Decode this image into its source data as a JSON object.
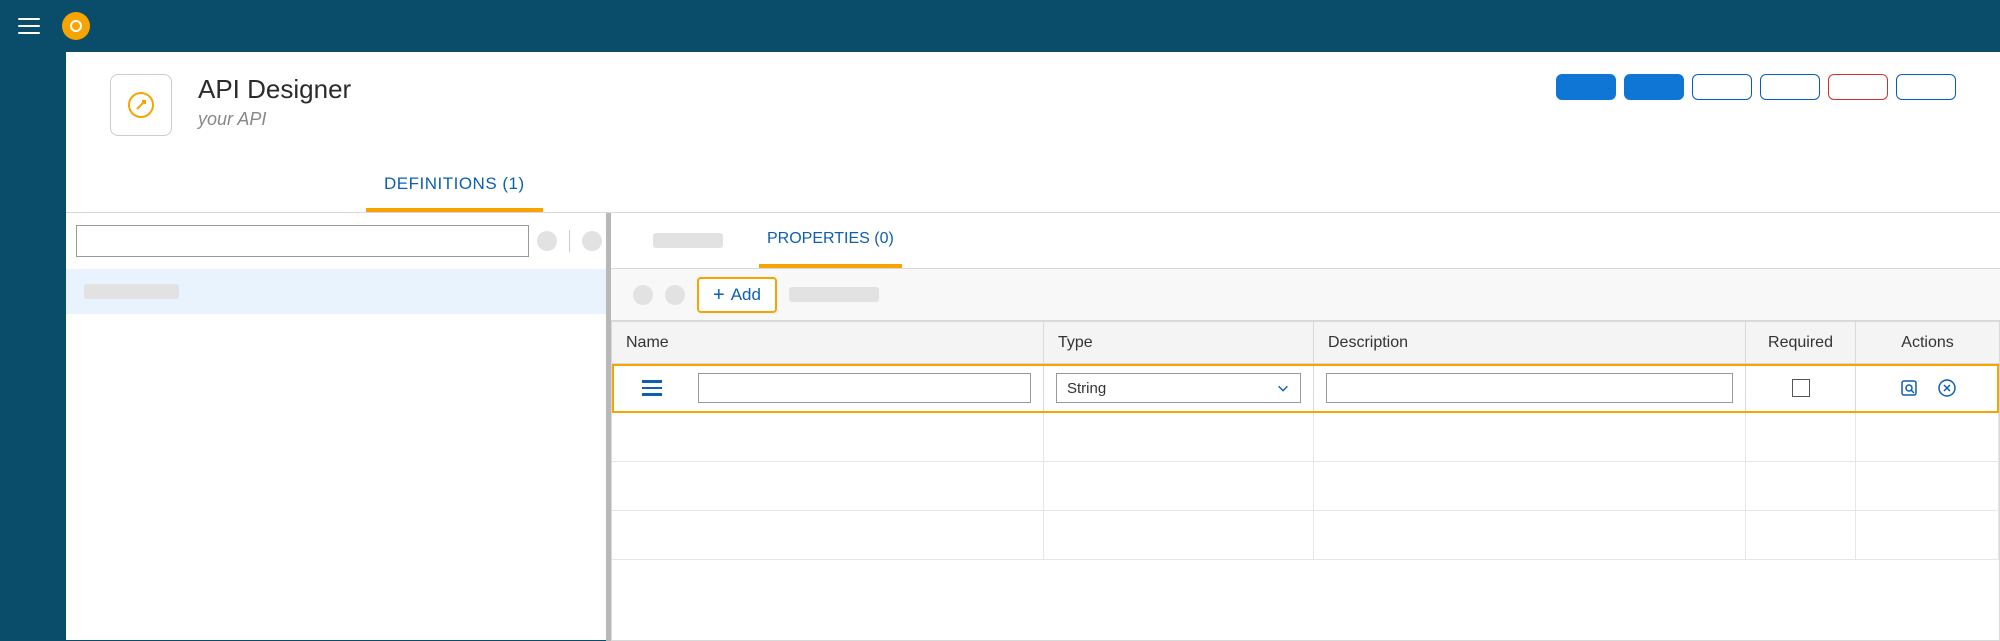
{
  "header": {
    "title": "API Designer",
    "subtitle": "your API"
  },
  "tabs": {
    "definitions_label": "DEFINITIONS (1)"
  },
  "detail": {
    "properties_tab_label": "PROPERTIES (0)",
    "add_button_label": "Add",
    "columns": {
      "name": "Name",
      "type": "Type",
      "description": "Description",
      "required": "Required",
      "actions": "Actions"
    },
    "row": {
      "name_value": "",
      "type_value": "String",
      "description_value": "",
      "required": false
    }
  },
  "search": {
    "placeholder": ""
  }
}
